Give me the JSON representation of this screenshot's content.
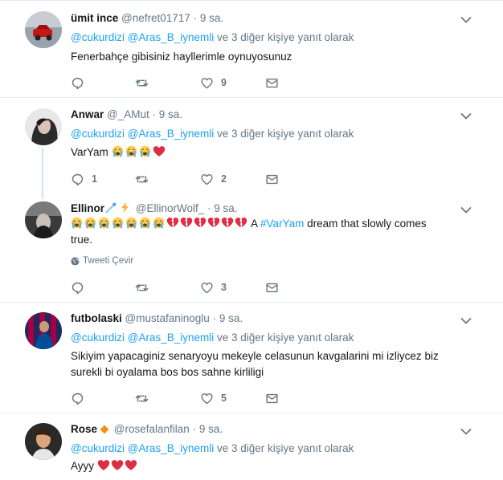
{
  "tweets": [
    {
      "name": "ümit ince",
      "handle": "@nefret01717",
      "sep": "·",
      "time": "9 sa.",
      "reply_to_1": "@cukurdizi",
      "reply_to_2": "@Aras_B_iynemli",
      "reply_suffix": "ve 3 diğer kişiye yanıt olarak",
      "text": "Fenerbahçe gibisiniz hayllerimle oynuyosunuz",
      "replies": "",
      "retweets": "",
      "likes": "9"
    },
    {
      "name": "Anwar",
      "handle": "@_AMut",
      "sep": "·",
      "time": "9 sa.",
      "reply_to_1": "@cukurdizi",
      "reply_to_2": "@Aras_B_iynemli",
      "reply_suffix": "ve 3 diğer kişiye yanıt olarak",
      "text": "VarYam",
      "emoji": [
        "crying-face",
        "crying-face",
        "crying-face",
        "red-heart"
      ],
      "replies": "1",
      "retweets": "",
      "likes": "2"
    },
    {
      "name": "Ellinor",
      "name_emoji": [
        "comet",
        "high-voltage"
      ],
      "handle": "@EllinorWolf_",
      "sep": "·",
      "time": "9 sa.",
      "emoji": [
        "crying-face",
        "crying-face",
        "crying-face",
        "crying-face",
        "crying-face",
        "crying-face",
        "crying-face",
        "broken-heart",
        "broken-heart",
        "broken-heart",
        "broken-heart",
        "broken-heart",
        "broken-heart"
      ],
      "text_prefix": "A",
      "hashtag": "#VarYam",
      "text_rest": "dream that slowly comes",
      "text_line2": "true.",
      "translate": "Tweeti Çevir",
      "replies": "",
      "retweets": "",
      "likes": "3"
    },
    {
      "name": "futbolaski",
      "handle": "@mustafaninoglu",
      "sep": "·",
      "time": "9 sa.",
      "reply_to_1": "@cukurdizi",
      "reply_to_2": "@Aras_B_iynemli",
      "reply_suffix": "ve 3 diğer kişiye yanıt olarak",
      "text_line1": "Sikiyim yapacaginiz senaryoyu mekeyle celasunun kavgalarini mi izliycez biz",
      "text_line2": "surekli bi oyalama bos bos sahne kirliligi",
      "replies": "",
      "retweets": "",
      "likes": "5"
    },
    {
      "name": "Rose",
      "name_emoji": [
        "orange-diamond"
      ],
      "handle": "@rosefalanfilan",
      "sep": "·",
      "time": "9 sa.",
      "reply_to_1": "@cukurdizi",
      "reply_to_2": "@Aras_B_iynemli",
      "reply_suffix": "ve 3 diğer kişiye yanıt olarak",
      "text": "Ayyy",
      "emoji": [
        "red-heart",
        "red-heart",
        "red-heart"
      ]
    }
  ],
  "colors": {
    "link": "#1da1f2",
    "muted": "#657786",
    "text": "#14171a",
    "separator": "#e6ecf0",
    "thread_line": "#cfe2f1",
    "heart": "#dd2e44",
    "crying_face": "#ffcc4d"
  }
}
